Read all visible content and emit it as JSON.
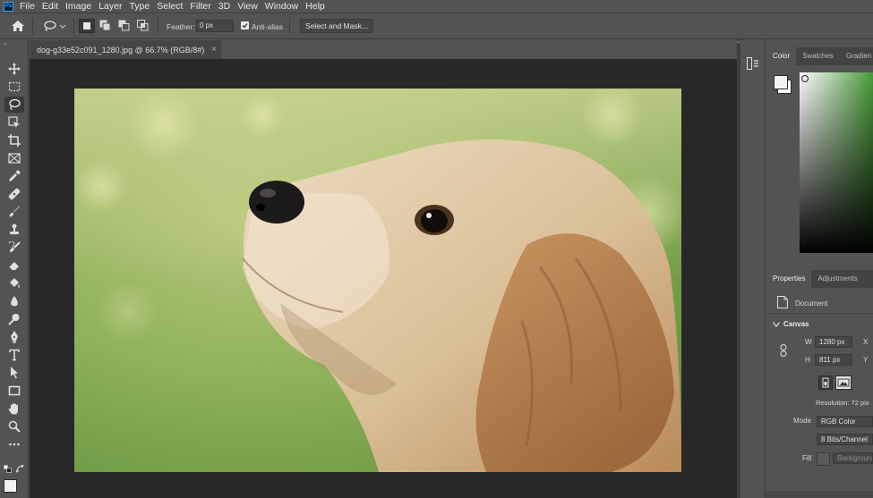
{
  "app": {
    "logo_text": "Ps"
  },
  "menu": [
    "File",
    "Edit",
    "Image",
    "Layer",
    "Type",
    "Select",
    "Filter",
    "3D",
    "View",
    "Window",
    "Help"
  ],
  "options_bar": {
    "feather_label": "Feather:",
    "feather_value": "0 px",
    "anti_alias_label": "Anti-alias",
    "anti_alias_checked": true,
    "select_mask_label": "Select and Mask..."
  },
  "document": {
    "tab_title": "dog-g33e52c091_1280.jpg @ 66.7% (RGB/8#)",
    "close_glyph": "×"
  },
  "color_panel": {
    "tabs": [
      "Color",
      "Swatches",
      "Gradien"
    ],
    "active_tab": "Color",
    "foreground_color": "#f2f2f2",
    "background_color": "#ffffff"
  },
  "properties_panel": {
    "tabs": [
      "Properties",
      "Adjustments"
    ],
    "active_tab": "Properties",
    "document_label": "Document",
    "canvas_label": "Canvas",
    "width_label": "W",
    "width_value": "1280 px",
    "height_label": "H",
    "height_value": "811 px",
    "x_label": "X",
    "y_label": "Y",
    "resolution": "Resolution: 72 pix",
    "mode_label": "Mode",
    "mode_value": "RGB Color",
    "bits_value": "8 Bits/Channel",
    "fill_label": "Fill",
    "fill_value": "Background"
  }
}
